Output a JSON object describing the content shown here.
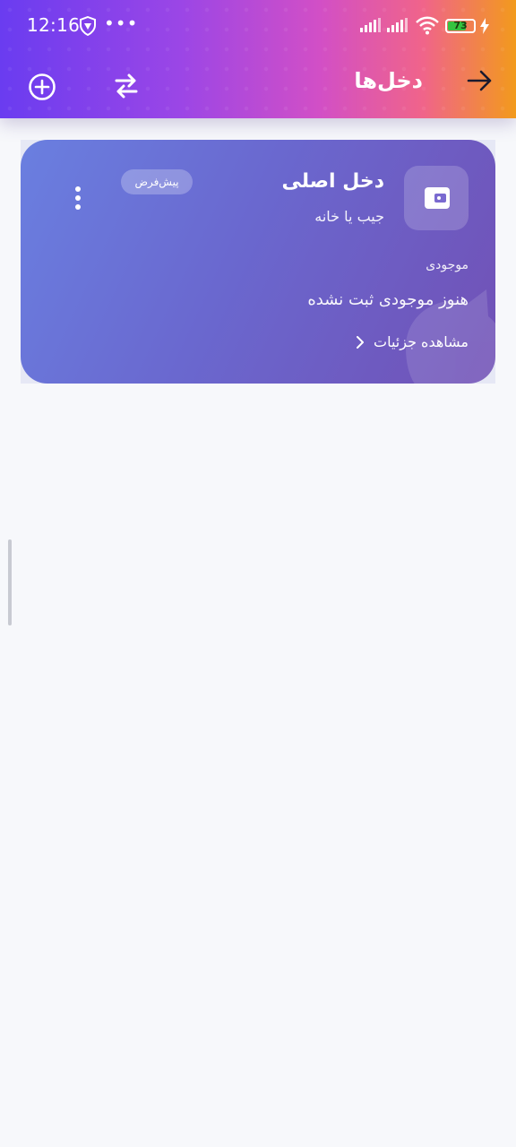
{
  "status_bar": {
    "time": "12:16",
    "more": "•••",
    "battery": "73",
    "battery_level": 0.73
  },
  "app_bar": {
    "title": "دخل‌ها",
    "back_icon": "arrow-right-icon",
    "transfer_icon": "swap-arrows-icon",
    "add_icon": "plus-circle-icon"
  },
  "income_card": {
    "name": "دخل اصلی",
    "subtitle": "جیب یا خانه",
    "badge": "پیش‌فرض",
    "balance_label": "موجودی",
    "balance_value": "هنوز موجودی ثبت نشده",
    "details_link": "مشاهده جزئیات",
    "icon": "wallet-icon",
    "menu_icon": "more-vertical-icon"
  },
  "colors": {
    "header_gradient": [
      "#6a3cf0",
      "#d24fc6",
      "#f29a1c"
    ],
    "card_gradient": [
      "#6a7fe0",
      "#7151b6"
    ],
    "background": "#f7f8fb"
  }
}
